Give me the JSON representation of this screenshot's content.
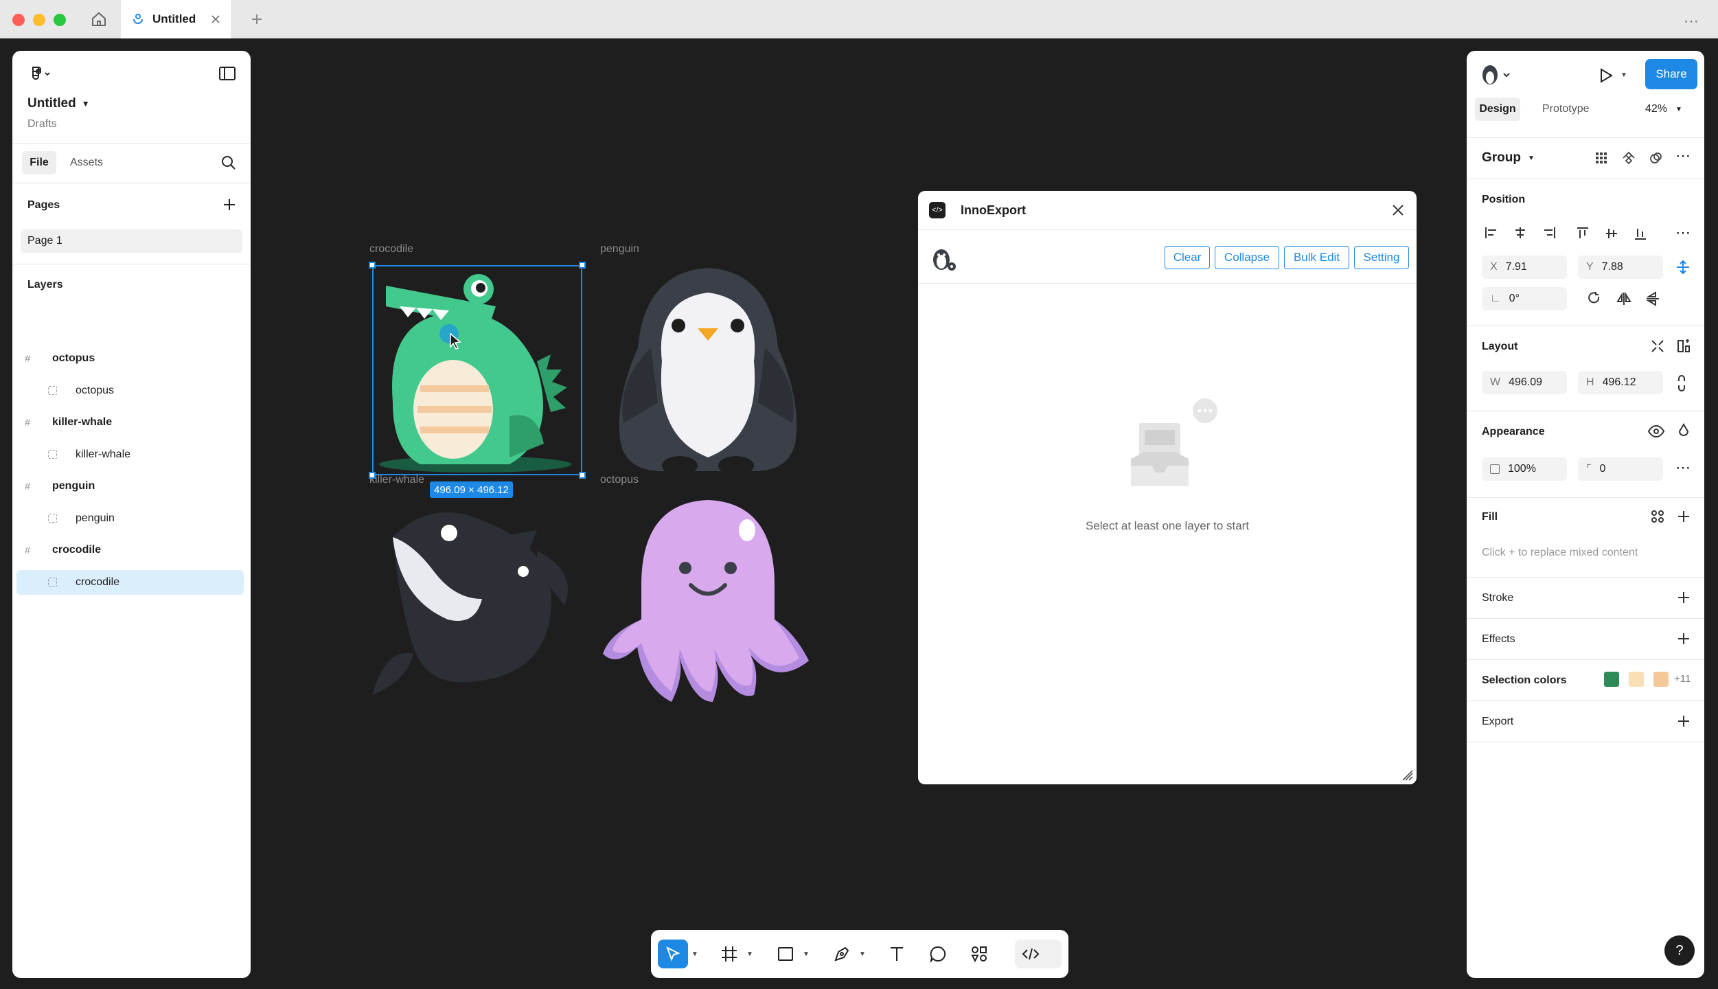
{
  "browser": {
    "tab_title": "Untitled",
    "traffic_colors": [
      "#ff5f57",
      "#febc2e",
      "#28c840"
    ]
  },
  "left_panel": {
    "file_title": "Untitled",
    "location": "Drafts",
    "tabs": [
      "File",
      "Assets"
    ],
    "pages_label": "Pages",
    "pages": [
      "Page 1"
    ],
    "layers_label": "Layers",
    "layers": [
      {
        "name": "octopus",
        "type": "frame"
      },
      {
        "name": "octopus",
        "type": "child"
      },
      {
        "name": "killer-whale",
        "type": "frame"
      },
      {
        "name": "killer-whale",
        "type": "child"
      },
      {
        "name": "penguin",
        "type": "frame"
      },
      {
        "name": "penguin",
        "type": "child"
      },
      {
        "name": "crocodile",
        "type": "frame"
      },
      {
        "name": "crocodile",
        "type": "child",
        "selected": true
      }
    ]
  },
  "canvas": {
    "labels": {
      "crocodile": "crocodile",
      "penguin": "penguin",
      "killer_whale": "killer-whale",
      "octopus": "octopus"
    },
    "selection_size": "496.09 × 496.12",
    "accent": "#1e88e5"
  },
  "plugin": {
    "title": "InnoExport",
    "buttons": [
      "Clear",
      "Collapse",
      "Bulk Edit",
      "Setting"
    ],
    "empty_message": "Select at least one layer to start"
  },
  "right_panel": {
    "share_label": "Share",
    "tabs": [
      "Design",
      "Prototype"
    ],
    "zoom": "42%",
    "selection_type": "Group",
    "position_label": "Position",
    "x_label": "X",
    "x_value": "7.91",
    "y_label": "Y",
    "y_value": "7.88",
    "rotation": "0°",
    "layout_label": "Layout",
    "w_label": "W",
    "w_value": "496.09",
    "h_label": "H",
    "h_value": "496.12",
    "appearance_label": "Appearance",
    "opacity": "100%",
    "radius": "0",
    "fill_label": "Fill",
    "fill_hint": "Click + to replace mixed content",
    "stroke_label": "Stroke",
    "effects_label": "Effects",
    "selection_colors_label": "Selection colors",
    "selection_colors": [
      "#2e8b57",
      "#f9dfb4",
      "#f5c89a"
    ],
    "selection_colors_more": "+11",
    "export_label": "Export"
  },
  "help_label": "?"
}
